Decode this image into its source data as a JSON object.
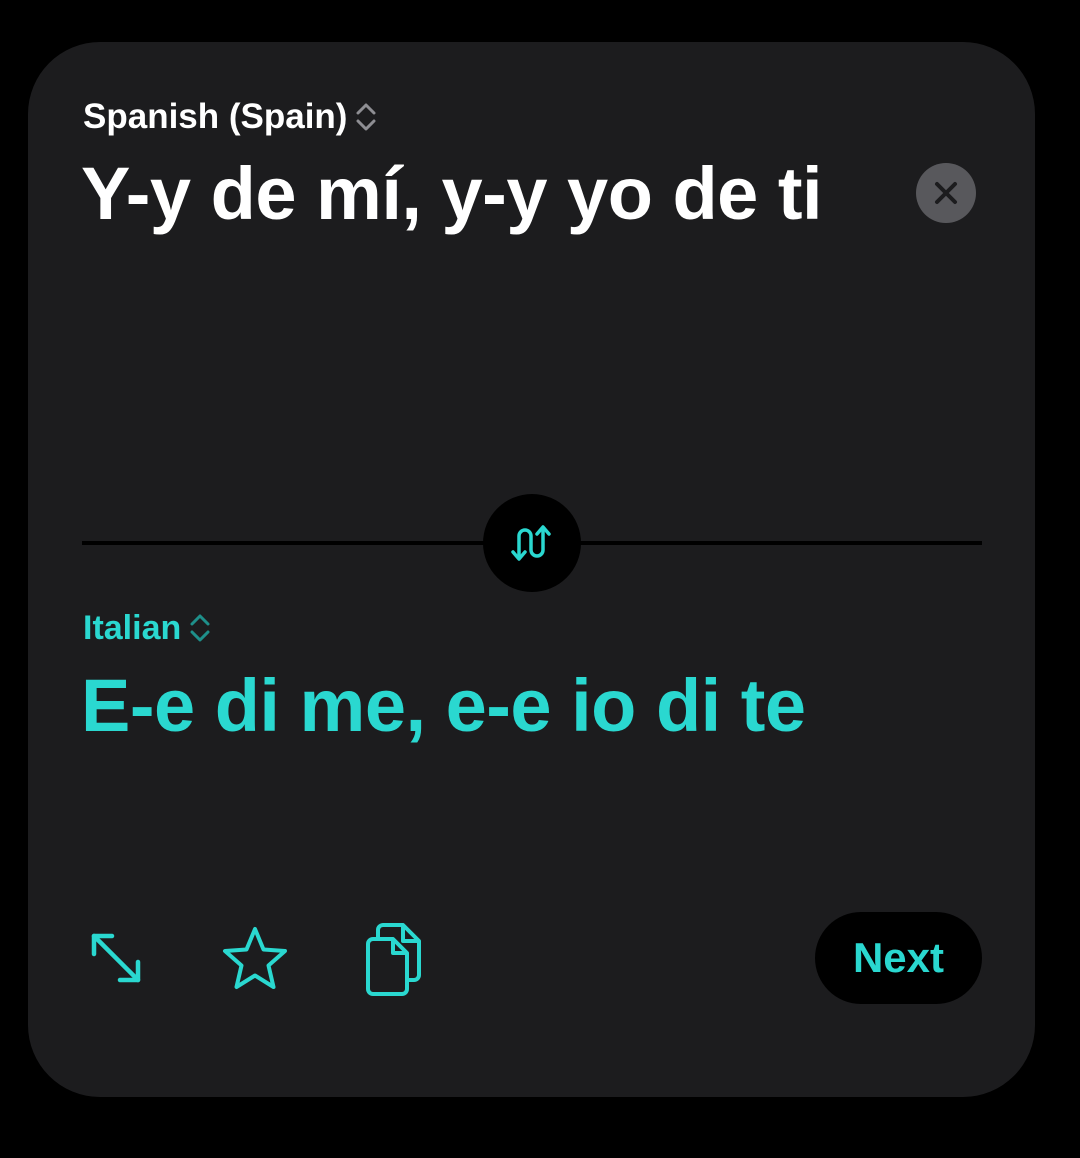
{
  "source": {
    "language": "Spanish (Spain)",
    "language_selector_icon": "chevron-up-down-icon",
    "text": "Y-y de mí, y-y yo de ti",
    "clear_icon": "close-icon"
  },
  "swap": {
    "icon": "swap-languages-icon"
  },
  "target": {
    "language": "Italian",
    "language_selector_icon": "chevron-up-down-icon",
    "text": "E-e di me, e-e io di te"
  },
  "toolbar": {
    "expand_icon": "expand-arrows-icon",
    "favorite_icon": "star-icon",
    "copy_icon": "copy-icon",
    "next_label": "Next"
  },
  "colors": {
    "background": "#000000",
    "card": "#1c1c1e",
    "accent": "#2ad8d0",
    "source_text": "#ffffff",
    "clear_button": "#58585c"
  }
}
